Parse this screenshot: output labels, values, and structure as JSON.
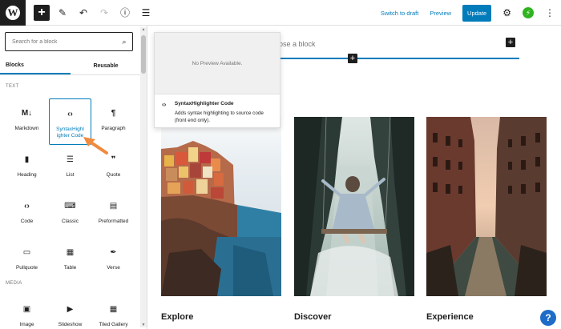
{
  "toolbar": {
    "logo_letter": "W",
    "add_icon": "+",
    "edit_icon": "✎",
    "undo_icon": "↶",
    "redo_icon": "↷",
    "info_icon": "ⓘ",
    "outline_icon": "☰",
    "switch_draft": "Switch to draft",
    "preview": "Preview",
    "update": "Update",
    "settings_icon": "⚙",
    "jetpack_icon": "⚡",
    "more_icon": "⋮"
  },
  "inserter": {
    "search_placeholder": "Search for a block",
    "search_icon": "⌕",
    "tabs": [
      {
        "label": "Blocks"
      },
      {
        "label": "Reusable"
      }
    ],
    "categories": {
      "text": "TEXT",
      "media": "MEDIA"
    },
    "text_blocks": [
      {
        "label": "Markdown",
        "icon": "M↓"
      },
      {
        "label": "SyntaxHighlighter Code",
        "icon": "‹›"
      },
      {
        "label": "Paragraph",
        "icon": "¶"
      },
      {
        "label": "Heading",
        "icon": "▮"
      },
      {
        "label": "List",
        "icon": "☰"
      },
      {
        "label": "Quote",
        "icon": "❞"
      },
      {
        "label": "Code",
        "icon": "‹›"
      },
      {
        "label": "Classic",
        "icon": "⌨"
      },
      {
        "label": "Preformatted",
        "icon": "▤"
      },
      {
        "label": "Pullquote",
        "icon": "▭"
      },
      {
        "label": "Table",
        "icon": "▦"
      },
      {
        "label": "Verse",
        "icon": "✒"
      }
    ],
    "media_blocks": [
      {
        "label": "Image",
        "icon": "▣"
      },
      {
        "label": "Slideshow",
        "icon": "▶"
      },
      {
        "label": "Tiled Gallery",
        "icon": "▦"
      }
    ]
  },
  "preview_popover": {
    "no_preview": "No Preview Available.",
    "icon": "‹›",
    "title": "SyntaxHighlighter Code",
    "description": "Adds syntax highlighting to source code (front end only)."
  },
  "canvas": {
    "choose_block": "ose a block",
    "columns": [
      {
        "title": "Explore"
      },
      {
        "title": "Discover"
      },
      {
        "title": "Experience"
      }
    ]
  },
  "help_icon": "?",
  "colors": {
    "accent": "#007cba",
    "arrow": "#f08a3e",
    "jetpack": "#2fb41f"
  }
}
